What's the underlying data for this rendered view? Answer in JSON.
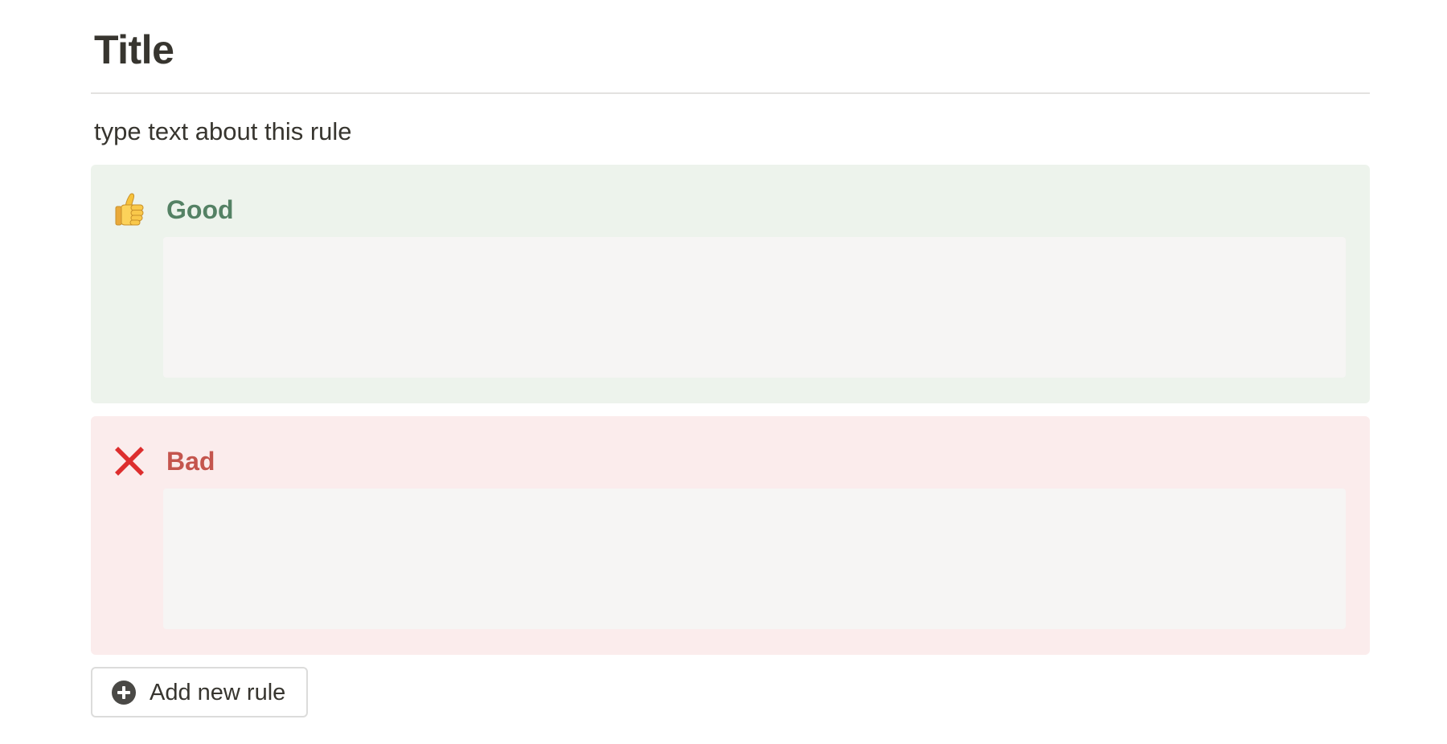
{
  "page": {
    "title": "Title",
    "description": "type text about this rule"
  },
  "callouts": {
    "good": {
      "icon": "thumbs-up-icon",
      "label": "Good",
      "body": "",
      "background_color": "#edf3ec",
      "label_color": "#548164"
    },
    "bad": {
      "icon": "cross-mark-icon",
      "label": "Bad",
      "body": "",
      "background_color": "#fbecec",
      "label_color": "#c4554d"
    }
  },
  "actions": {
    "add_rule_label": "Add new rule",
    "add_rule_icon": "plus-circle-icon"
  }
}
